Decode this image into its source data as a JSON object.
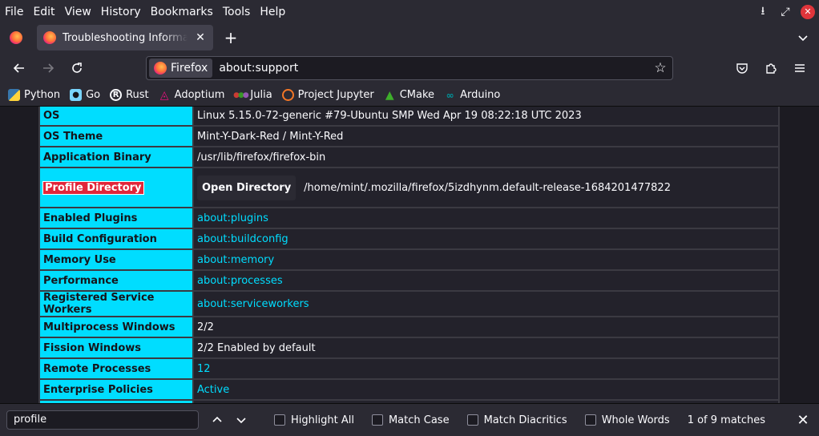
{
  "menu": [
    "File",
    "Edit",
    "View",
    "History",
    "Bookmarks",
    "Tools",
    "Help"
  ],
  "window": {
    "close_label": "✕"
  },
  "tab": {
    "title": "Troubleshooting Information",
    "close": "✕"
  },
  "newtab": "+",
  "urlbar": {
    "identity_label": "Firefox",
    "url": "about:support"
  },
  "bookmarks": [
    {
      "label": "Python",
      "icon": "python-icon",
      "color": "#3776ab"
    },
    {
      "label": "Go",
      "icon": "gopher-icon",
      "color": "#79d4fd"
    },
    {
      "label": "Rust",
      "icon": "rust-icon",
      "color": "#ffffff"
    },
    {
      "label": "Adoptium",
      "icon": "adoptium-icon",
      "color": "#e3127c"
    },
    {
      "label": "Julia",
      "icon": "julia-icon",
      "color": "#9558b2"
    },
    {
      "label": "Project Jupyter",
      "icon": "jupyter-icon",
      "color": "#f37726"
    },
    {
      "label": "CMake",
      "icon": "cmake-icon",
      "color": "#064f8c"
    },
    {
      "label": "Arduino",
      "icon": "arduino-icon",
      "color": "#00979d"
    }
  ],
  "rows": [
    {
      "key": "OS",
      "value": "Linux 5.15.0-72-generic #79-Ubuntu SMP Wed Apr 19 08:22:18 UTC 2023"
    },
    {
      "key": "OS Theme",
      "value": "Mint-Y-Dark-Red / Mint-Y-Red"
    },
    {
      "key": "Application Binary",
      "value": "/usr/lib/firefox/firefox-bin"
    },
    {
      "key": "Profile Directory",
      "button": "Open Directory",
      "value": "/home/mint/.mozilla/firefox/5izdhynm.default-release-1684201477822"
    },
    {
      "key": "Enabled Plugins",
      "value": "about:plugins"
    },
    {
      "key": "Build Configuration",
      "value": "about:buildconfig"
    },
    {
      "key": "Memory Use",
      "value": "about:memory"
    },
    {
      "key": "Performance",
      "value": "about:processes"
    },
    {
      "key": "Registered Service Workers",
      "value": "about:serviceworkers"
    },
    {
      "key": "Multiprocess Windows",
      "value": "2/2"
    },
    {
      "key": "Fission Windows",
      "value": "2/2 Enabled by default"
    },
    {
      "key": "Remote Processes",
      "value": "12"
    },
    {
      "key": "Enterprise Policies",
      "value": "Active"
    }
  ],
  "find": {
    "query": "profile",
    "highlight_all": "Highlight All",
    "match_case": "Match Case",
    "match_diacritics": "Match Diacritics",
    "whole_words": "Whole Words",
    "status": "1 of 9 matches"
  }
}
